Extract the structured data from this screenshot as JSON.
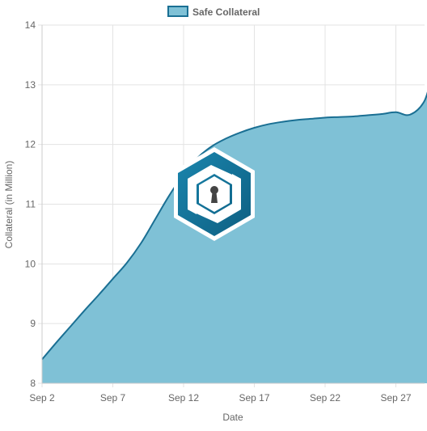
{
  "colors": {
    "fill": "#7fc1d6",
    "line": "#1a6f93",
    "grid": "#e3e3e3",
    "axis_text": "#666666",
    "legend_text": "#666666",
    "logo_dark": "#0e5f82",
    "logo_light": "#1a85ad"
  },
  "logo": {
    "icon": "keyhole-hexagon-logo"
  },
  "chart_data": {
    "type": "area",
    "legend": {
      "position": "top-center",
      "entries": [
        "Safe Collateral"
      ]
    },
    "xlabel": "Date",
    "ylabel": "Collateral (in Million)",
    "x_ticks": [
      "Sep 2",
      "Sep 7",
      "Sep 12",
      "Sep 17",
      "Sep 22",
      "Sep 27"
    ],
    "y_ticks": [
      "8",
      "9",
      "10",
      "11",
      "12",
      "13",
      "14"
    ],
    "ylim": [
      8,
      14
    ],
    "grid": true,
    "series": [
      {
        "name": "Safe Collateral",
        "x": [
          "2021-09-02",
          "2021-09-03",
          "2021-09-04",
          "2021-09-05",
          "2021-09-06",
          "2021-09-07",
          "2021-09-08",
          "2021-09-09",
          "2021-09-10",
          "2021-09-11",
          "2021-09-12",
          "2021-09-13",
          "2021-09-14",
          "2021-09-15",
          "2021-09-16",
          "2021-09-17",
          "2021-09-18",
          "2021-09-19",
          "2021-09-20",
          "2021-09-21",
          "2021-09-22",
          "2021-09-23",
          "2021-09-24",
          "2021-09-25",
          "2021-09-26",
          "2021-09-27",
          "2021-09-28",
          "2021-09-29",
          "2021-09-29 12:00"
        ],
        "values": [
          8.4,
          8.68,
          8.95,
          9.22,
          9.48,
          9.75,
          10.02,
          10.35,
          10.75,
          11.15,
          11.5,
          11.78,
          11.97,
          12.1,
          12.2,
          12.28,
          12.34,
          12.38,
          12.41,
          12.43,
          12.45,
          12.46,
          12.47,
          12.49,
          12.51,
          12.54,
          12.5,
          12.72,
          13.12
        ]
      }
    ]
  }
}
